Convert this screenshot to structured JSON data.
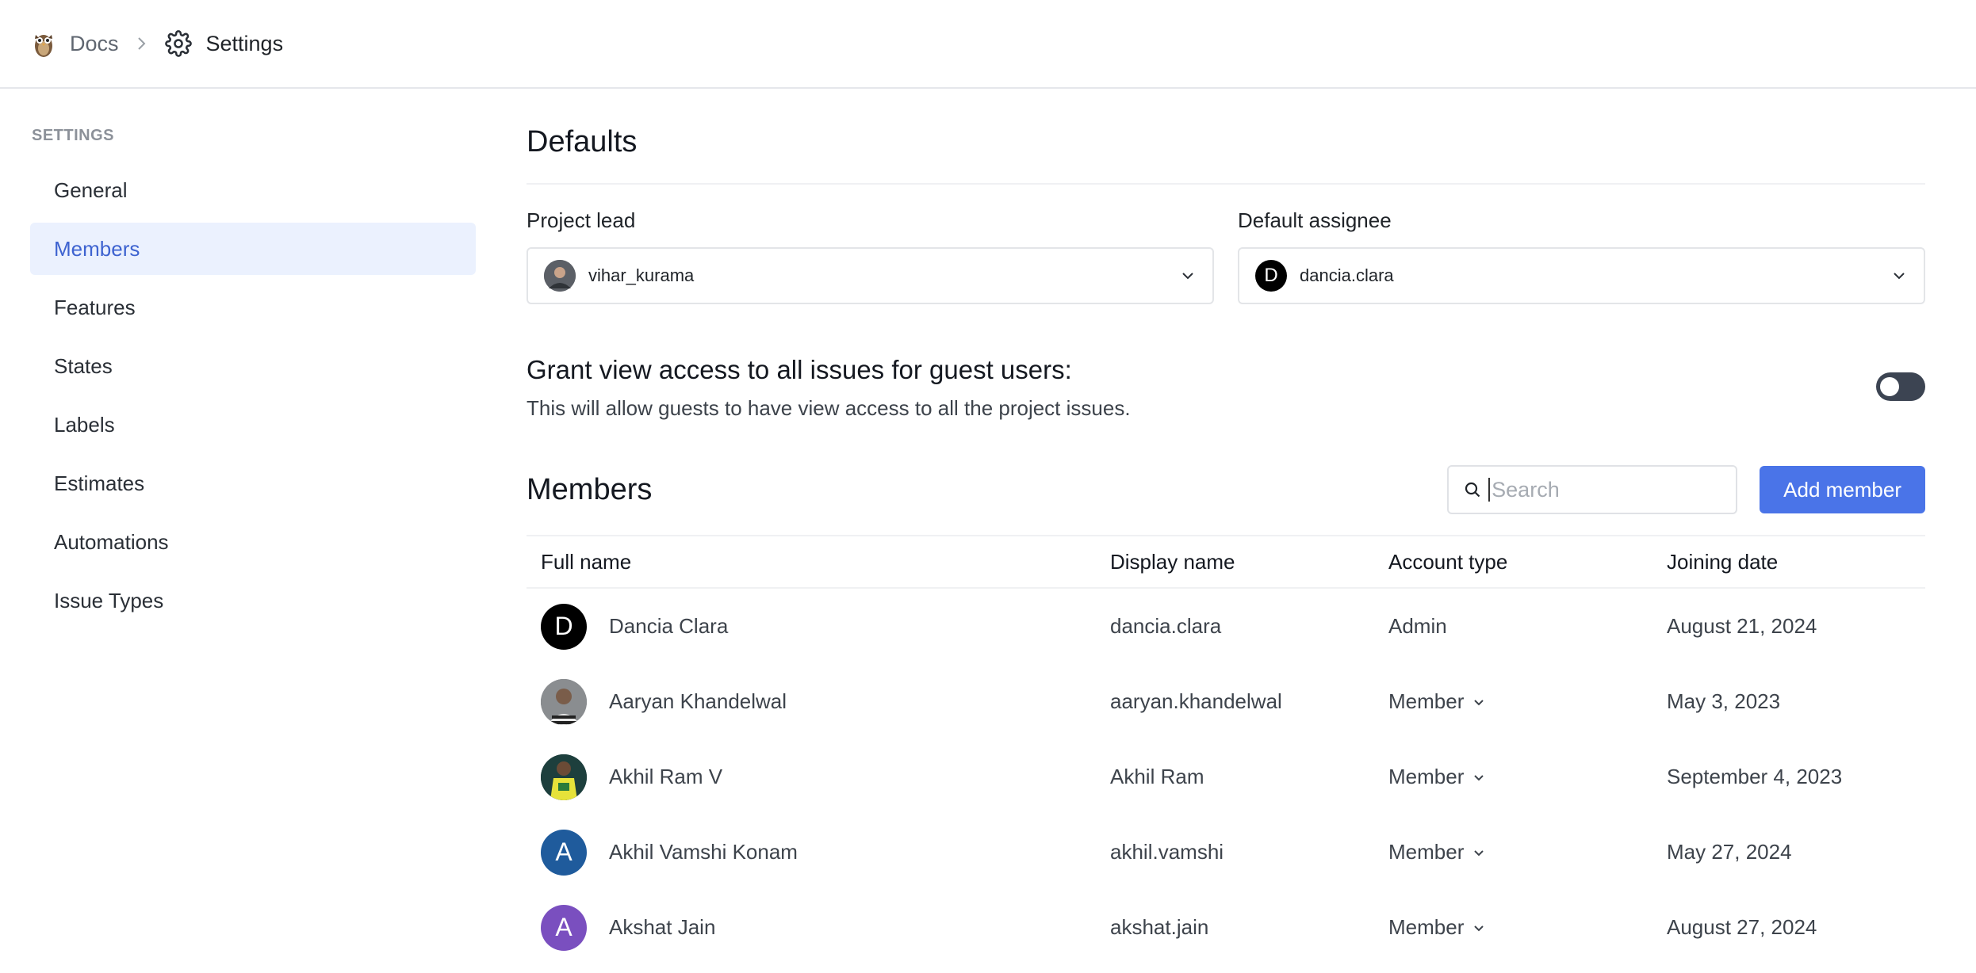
{
  "breadcrumb": {
    "project": "Docs",
    "page": "Settings"
  },
  "sidebar": {
    "title": "SETTINGS",
    "items": [
      {
        "label": "General",
        "active": false
      },
      {
        "label": "Members",
        "active": true
      },
      {
        "label": "Features",
        "active": false
      },
      {
        "label": "States",
        "active": false
      },
      {
        "label": "Labels",
        "active": false
      },
      {
        "label": "Estimates",
        "active": false
      },
      {
        "label": "Automations",
        "active": false
      },
      {
        "label": "Issue Types",
        "active": false
      }
    ]
  },
  "defaults": {
    "heading": "Defaults",
    "project_lead": {
      "label": "Project lead",
      "value": "vihar_kurama"
    },
    "default_assignee": {
      "label": "Default assignee",
      "value": "dancia.clara",
      "avatar_letter": "D"
    }
  },
  "guest_access": {
    "title": "Grant view access to all issues for guest users:",
    "description": "This will allow guests to have view access to all the project issues.",
    "enabled": false
  },
  "members": {
    "heading": "Members",
    "search_placeholder": "Search",
    "add_button": "Add member",
    "columns": [
      "Full name",
      "Display name",
      "Account type",
      "Joining date"
    ],
    "rows": [
      {
        "full_name": "Dancia Clara",
        "display_name": "dancia.clara",
        "account_type": "Admin",
        "joining_date": "August 21, 2024",
        "avatar_letter": "D",
        "avatar_color": "#000000",
        "editable": false
      },
      {
        "full_name": "Aaryan Khandelwal",
        "display_name": "aaryan.khandelwal",
        "account_type": "Member",
        "joining_date": "May 3, 2023",
        "avatar_letter": "",
        "avatar_color": "#6b6f73",
        "editable": true
      },
      {
        "full_name": "Akhil Ram V",
        "display_name": "Akhil Ram",
        "account_type": "Member",
        "joining_date": "September 4, 2023",
        "avatar_letter": "",
        "avatar_color": "#1f3b3a",
        "editable": true
      },
      {
        "full_name": "Akhil Vamshi Konam",
        "display_name": "akhil.vamshi",
        "account_type": "Member",
        "joining_date": "May 27, 2024",
        "avatar_letter": "A",
        "avatar_color": "#1f5b9c",
        "editable": true
      },
      {
        "full_name": "Akshat Jain",
        "display_name": "akshat.jain",
        "account_type": "Member",
        "joining_date": "August 27, 2024",
        "avatar_letter": "A",
        "avatar_color": "#7a4fbf",
        "editable": true
      }
    ]
  },
  "colors": {
    "accent": "#4a74e8",
    "active_nav_bg": "#ebf1fe",
    "active_nav_text": "#3e63d0",
    "toggle_bg": "#3c4452"
  }
}
